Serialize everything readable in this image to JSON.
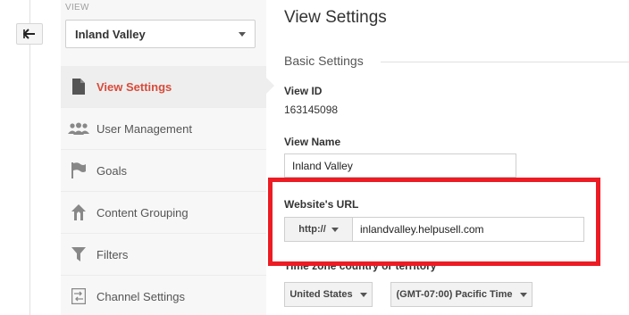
{
  "nav": {
    "view_label": "VIEW",
    "view_selected": "Inland Valley",
    "items": [
      {
        "label": "View Settings",
        "icon": "document-icon",
        "active": true
      },
      {
        "label": "User Management",
        "icon": "users-icon",
        "active": false
      },
      {
        "label": "Goals",
        "icon": "flag-icon",
        "active": false
      },
      {
        "label": "Content Grouping",
        "icon": "grouping-icon",
        "active": false
      },
      {
        "label": "Filters",
        "icon": "filter-icon",
        "active": false
      },
      {
        "label": "Channel Settings",
        "icon": "channel-icon",
        "active": false
      }
    ]
  },
  "main": {
    "title": "View Settings",
    "section": "Basic Settings",
    "view_id_label": "View ID",
    "view_id_value": "163145098",
    "view_name_label": "View Name",
    "view_name_value": "Inland Valley",
    "website_url_label": "Website's URL",
    "protocol": "http://",
    "website_url_value": "inlandvalley.helpusell.com",
    "timezone_label": "Time zone country or territory",
    "country": "United States",
    "timezone": "(GMT-07:00) Pacific Time"
  },
  "colors": {
    "accent": "#d84b3a",
    "highlight": "#ec1c24"
  }
}
